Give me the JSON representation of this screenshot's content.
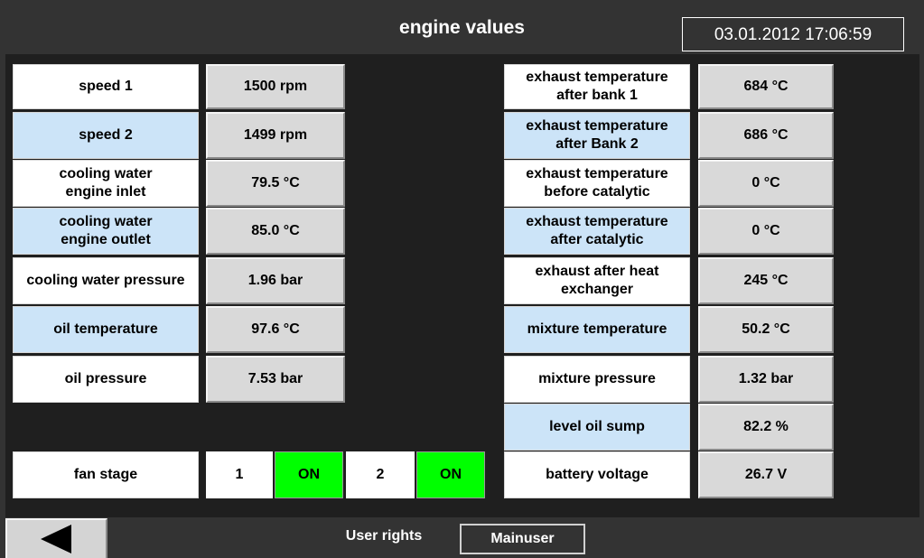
{
  "header": {
    "title": "engine values",
    "datetime": "03.01.2012 17:06:59"
  },
  "left": [
    {
      "label": "speed 1",
      "value": "1500 rpm"
    },
    {
      "label": "speed 2",
      "value": "1499 rpm"
    },
    {
      "label": "cooling water engine inlet",
      "value": "79.5 °C"
    },
    {
      "label": "cooling water engine outlet",
      "value": "85.0 °C"
    },
    {
      "label": "cooling water pressure",
      "value": "1.96 bar"
    },
    {
      "label": "oil temperature",
      "value": "97.6 °C"
    },
    {
      "label": "oil pressure",
      "value": "7.53 bar"
    }
  ],
  "right": [
    {
      "label": "exhaust temperature after bank 1",
      "value": "684 °C"
    },
    {
      "label": "exhaust temperature after Bank 2",
      "value": "686 °C"
    },
    {
      "label": "exhaust temperature before catalytic",
      "value": "0 °C"
    },
    {
      "label": "exhaust temperature after catalytic",
      "value": "0 °C"
    },
    {
      "label": "exhaust after heat exchanger",
      "value": "245 °C"
    },
    {
      "label": "mixture temperature",
      "value": "50.2 °C"
    },
    {
      "label": "mixture pressure",
      "value": "1.32 bar"
    },
    {
      "label": "level oil sump",
      "value": "82.2 %"
    },
    {
      "label": "battery voltage",
      "value": "26.7 V"
    }
  ],
  "fan": {
    "label": "fan stage",
    "stages": [
      {
        "number": "1",
        "status": "ON"
      },
      {
        "number": "2",
        "status": "ON"
      }
    ]
  },
  "footer": {
    "user_rights_label": "User rights",
    "user_button": "Mainuser",
    "back_icon": "back-arrow-icon"
  },
  "colors": {
    "on": "#00ff00",
    "label_blue": "#cce4f8",
    "value_gray": "#d9d9d9"
  }
}
